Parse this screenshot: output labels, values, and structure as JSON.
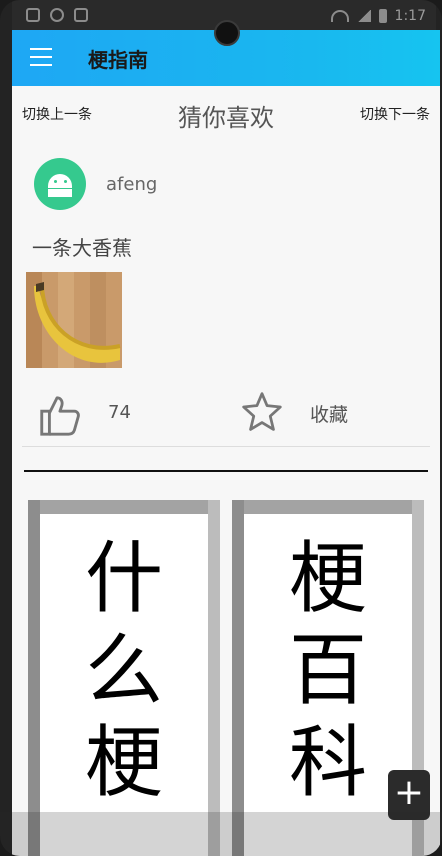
{
  "status": {
    "time": "1:17"
  },
  "appbar": {
    "title": "梗指南",
    "menu_icon": "menu-icon"
  },
  "feed": {
    "switch_prev": "切换上一条",
    "title": "猜你喜欢",
    "switch_next": "切换下一条"
  },
  "post": {
    "username": "afeng",
    "text": "一条大香蕉",
    "likes": "74",
    "collect_label": "收藏",
    "like_icon": "thumbs-up-icon",
    "star_icon": "star-icon",
    "avatar_icon": "android-avatar-icon"
  },
  "banners": {
    "left": [
      "什",
      "么",
      "梗"
    ],
    "right": [
      "梗",
      "百",
      "科"
    ]
  },
  "fab": {
    "label": "+"
  },
  "colors": {
    "appbar_start": "#1ea7f4",
    "appbar_end": "#16c4f0",
    "avatar": "#35c98e"
  }
}
